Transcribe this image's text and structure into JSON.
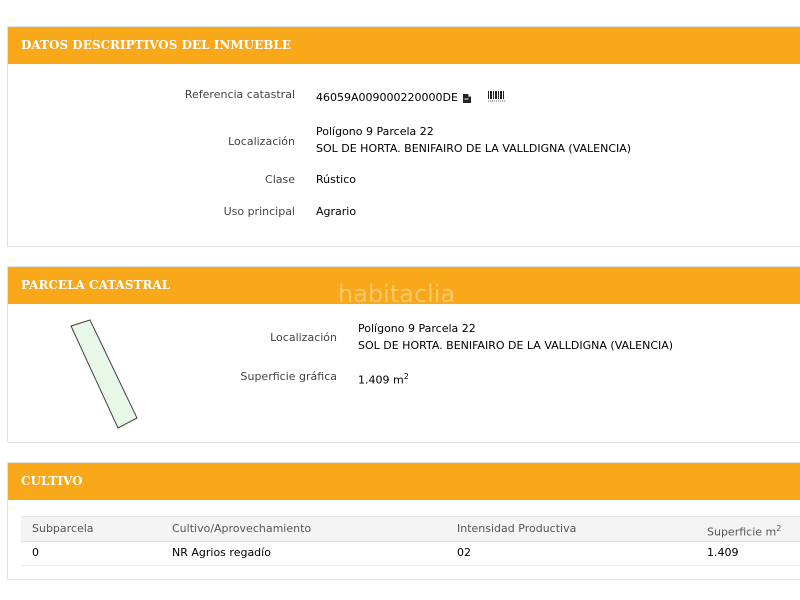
{
  "panel1": {
    "title": "DATOS DESCRIPTIVOS DEL INMUEBLE",
    "ref_label": "Referencia catastral",
    "ref_value": "46059A009000220000DE",
    "loc_label": "Localización",
    "loc_line1": "Polígono 9 Parcela 22",
    "loc_line2": "SOL DE HORTA. BENIFAIRO DE LA VALLDIGNA (VALENCIA)",
    "clase_label": "Clase",
    "clase_value": "Rústico",
    "uso_label": "Uso principal",
    "uso_value": "Agrario"
  },
  "panel2": {
    "title": "PARCELA CATASTRAL",
    "loc_label": "Localización",
    "loc_line1": "Polígono 9 Parcela 22",
    "loc_line2": "SOL DE HORTA. BENIFAIRO DE LA VALLDIGNA (VALENCIA)",
    "sup_label": "Superficie gráfica",
    "sup_value": "1.409 m",
    "sup_unit_exp": "2"
  },
  "panel3": {
    "title": "CULTIVO",
    "headers": [
      "Subparcela",
      "Cultivo/Aprovechamiento",
      "Intensidad Productiva",
      "Superficie m"
    ],
    "header_exp": "2",
    "rows": [
      [
        "0",
        "NR Agrios regadío",
        "02",
        "1.409"
      ]
    ]
  },
  "watermark": "habitaclia",
  "colors": {
    "header_bg": "#f8a818",
    "parcel_fill": "#e8f8e8",
    "parcel_stroke": "#404040"
  },
  "icons": [
    "document-icon",
    "barcode-icon"
  ]
}
